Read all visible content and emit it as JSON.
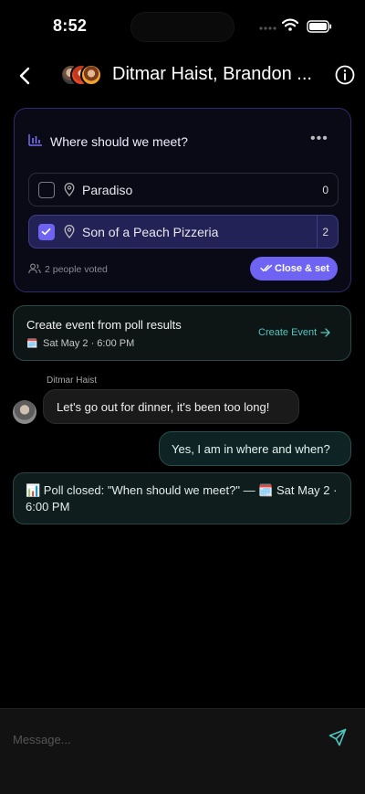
{
  "status": {
    "time": "8:52",
    "icons": [
      "signal-dots-icon",
      "wifi-icon",
      "battery-icon"
    ]
  },
  "header": {
    "title": "Ditmar Haist, Brandon ...",
    "back_icon": "chevron-left-icon",
    "info_icon": "info-icon"
  },
  "poll": {
    "question": "Where should we meet?",
    "icon": "bar-chart-icon",
    "menu_icon": "more-horizontal-icon",
    "options": [
      {
        "label": "Paradiso",
        "count": "0",
        "checked": false
      },
      {
        "label": "Son of a Peach Pizzeria",
        "count": "2",
        "checked": true
      }
    ],
    "voted_text": "2 people voted",
    "close_label": "Close & set",
    "accent": "#6E63F2"
  },
  "event": {
    "title": "Create event from poll results",
    "date": "Sat May 2 · 6:00 PM",
    "cta": "Create Event",
    "accent": "#4FC6C0"
  },
  "messages": {
    "sender_name": "Ditmar Haist",
    "incoming": "Let's go out for dinner, it's been too long!",
    "outgoing": "Yes, I am in where and when?",
    "system": "📊 Poll closed: \"When should we meet?\" — 🗓️ Sat May 2 · 6:00 PM"
  },
  "composer": {
    "placeholder": "Message...",
    "send_icon": "send-icon"
  }
}
